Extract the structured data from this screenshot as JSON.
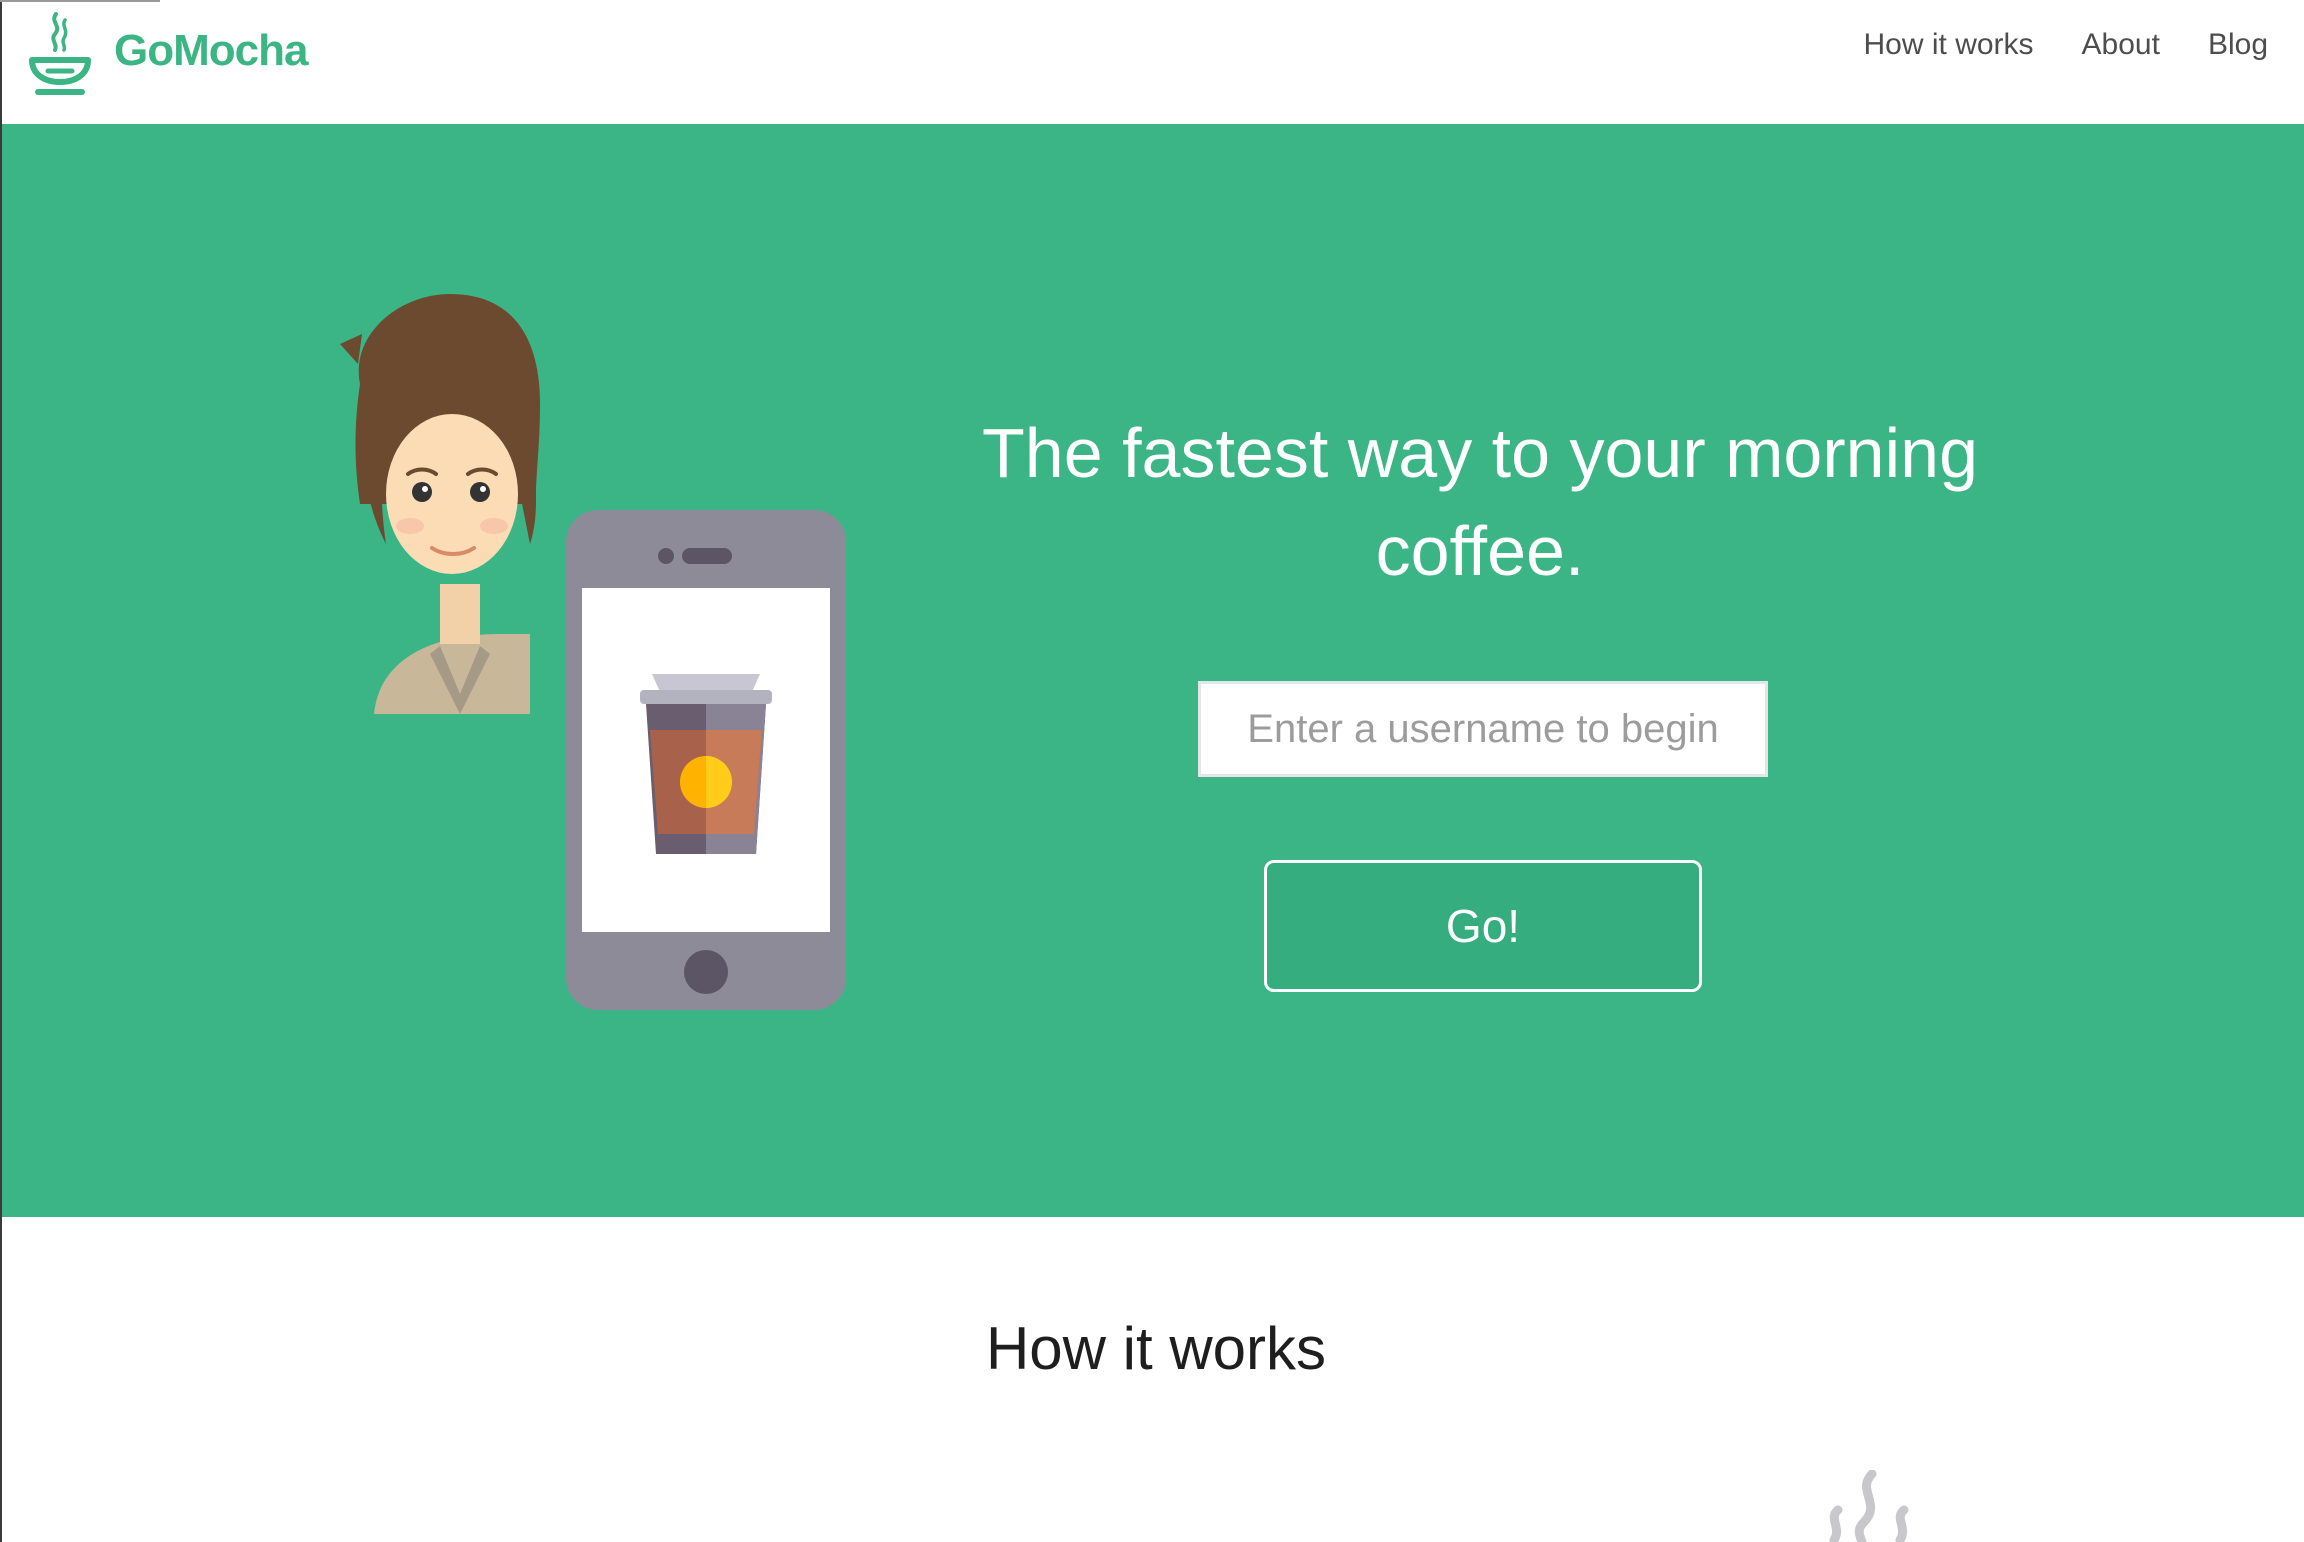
{
  "header": {
    "brand": "GoMocha",
    "nav": [
      {
        "label": "How it works"
      },
      {
        "label": "About"
      },
      {
        "label": "Blog"
      }
    ]
  },
  "hero": {
    "headline": "The fastest way to your morning coffee.",
    "input_placeholder": "Enter a username to begin",
    "button_label": "Go!"
  },
  "how_it_works": {
    "title": "How it works"
  },
  "colors": {
    "brand_green": "#3bb583",
    "hero_background": "#3bb585",
    "button_fill": "#35ad7e",
    "nav_text": "#4d4d4d"
  },
  "icons": {
    "logo": "coffee-cup-steam-icon",
    "illustration": "person-with-phone-coffee-illustration",
    "partial_footer_icon": "steam-icon"
  }
}
